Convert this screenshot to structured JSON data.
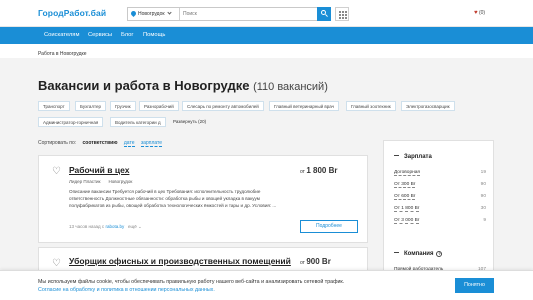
{
  "header": {
    "logo": "ГородРабот.бай",
    "city": "Новогрудок",
    "search_placeholder": "Поиск",
    "favorites": "(0)"
  },
  "nav": [
    "Соискателям",
    "Сервисы",
    "Блог",
    "Помощь"
  ],
  "breadcrumb": "Работа в Новогрудке",
  "page": {
    "title": "Вакансии и работа в Новогрудке",
    "count": "(110 вакансий)"
  },
  "tags": [
    "Транспорт",
    "Бухгалтер",
    "Грузчик",
    "Разнорабочий",
    "Слесарь по ремонту автомобилей",
    "Главный ветеринарный врач",
    "Главный зоотехник",
    "Электрогазосварщик",
    "Администратор-горничная",
    "Водитель категории д"
  ],
  "tags_more": "Развернуть (20)",
  "sort": {
    "label": "Сортировать по:",
    "options": [
      "соответствию",
      "дате",
      "зарплате"
    ]
  },
  "vacancies": [
    {
      "title": "Рабочий в цех",
      "company": "Лидер Пластик",
      "city": "Новогрудок",
      "description": "Описание вакансии Требуется рабочий в цех Требования: исполнительность трудолюбие ответственность Должностные обязанности: обработка рыбы и овощей укладка в вакуум полуфабрикатов из рыбы, овощей обработка технологических ёмкостей и тары и др. Условия: ...",
      "time": "13 часов назад с",
      "source": "rabota.by",
      "more_menu": "ещё",
      "salary_prefix": "от",
      "salary": "1 800 Br",
      "button": "Подробнее"
    },
    {
      "title": "Уборщик офисных и производственных помещений",
      "salary_prefix": "от",
      "salary": "900 Br"
    }
  ],
  "filters": {
    "salary_title": "Зарплата",
    "salary_rows": [
      {
        "label": "Договорная",
        "count": "19"
      },
      {
        "label": "От 300 Br",
        "count": "90"
      },
      {
        "label": "От 600 Br",
        "count": "90"
      },
      {
        "label": "От 1 800 Br",
        "count": "30"
      },
      {
        "label": "От 3 000 Br",
        "count": "9"
      }
    ],
    "company_title": "Компания",
    "company_rows": [
      {
        "label": "Прямой работодатель",
        "count": "107"
      }
    ]
  },
  "cookie": {
    "text": "Мы используем файлы cookie, чтобы обеспечивать правильную работу нашего веб-сайта и анализировать сетевой трафик.",
    "link": "Согласие на обработку и политика в отношении персональных данных.",
    "button": "Понятно"
  }
}
